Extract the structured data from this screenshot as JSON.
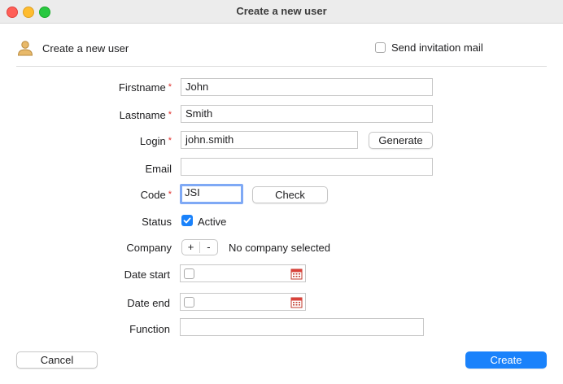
{
  "window": {
    "title": "Create a new user"
  },
  "header": {
    "title": "Create a new user",
    "invitation_label": "Send invitation mail"
  },
  "form": {
    "firstname": {
      "label": "Firstname",
      "value": "John",
      "required": "*"
    },
    "lastname": {
      "label": "Lastname",
      "value": "Smith",
      "required": "*"
    },
    "login": {
      "label": "Login",
      "value": "john.smith",
      "required": "*",
      "button": "Generate"
    },
    "email": {
      "label": "Email",
      "value": ""
    },
    "code": {
      "label": "Code",
      "value": "JSI",
      "required": "*",
      "button": "Check"
    },
    "status": {
      "label": "Status",
      "checkbox_label": "Active",
      "checked": true
    },
    "company": {
      "label": "Company",
      "add": "+",
      "remove": "-",
      "value": "No company selected"
    },
    "date_start": {
      "label": "Date start"
    },
    "date_end": {
      "label": "Date end"
    },
    "function": {
      "label": "Function",
      "value": ""
    }
  },
  "footer": {
    "cancel": "Cancel",
    "create": "Create"
  },
  "colors": {
    "accent": "#1a82fb",
    "required": "#e0302d",
    "focus": "#7fa9f5"
  }
}
